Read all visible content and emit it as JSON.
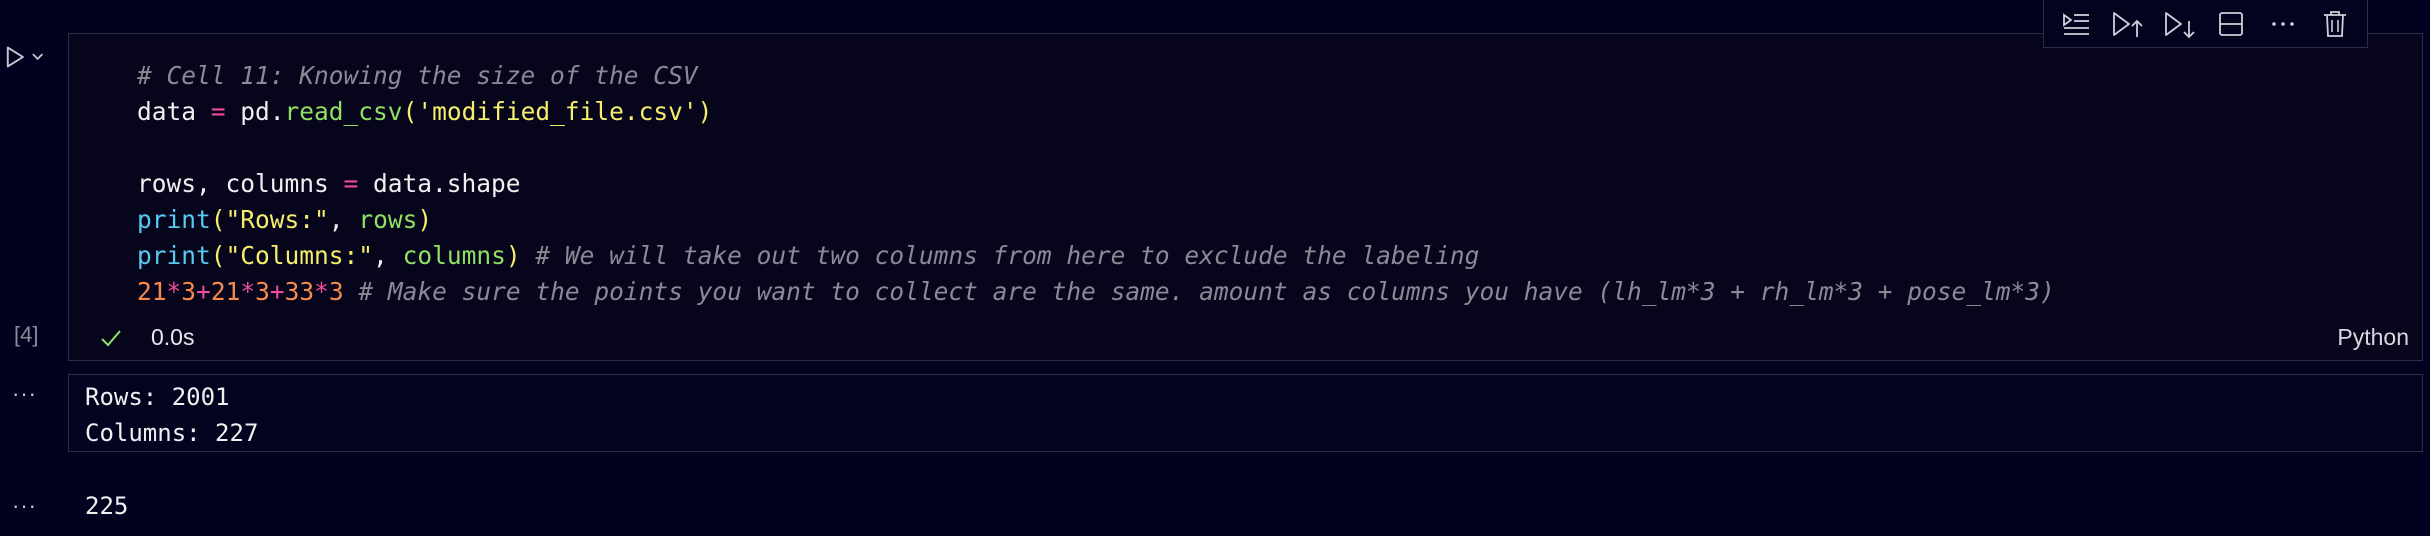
{
  "cell": {
    "execution_count": "[4]",
    "duration": "0.0s",
    "language": "Python",
    "code_lines": [
      [
        {
          "t": "# Cell 11: Knowing the size of the CSV",
          "c": "cm"
        }
      ],
      [
        {
          "t": "data ",
          "c": "vr"
        },
        {
          "t": "=",
          "c": "op"
        },
        {
          "t": " pd.",
          "c": "vr"
        },
        {
          "t": "read_csv",
          "c": "fn"
        },
        {
          "t": "(",
          "c": "pn"
        },
        {
          "t": "'modified_file.csv'",
          "c": "st"
        },
        {
          "t": ")",
          "c": "pn"
        }
      ],
      [],
      [
        {
          "t": "rows, columns ",
          "c": "vr"
        },
        {
          "t": "=",
          "c": "op"
        },
        {
          "t": " data.shape",
          "c": "vr"
        }
      ],
      [
        {
          "t": "print",
          "c": "bi"
        },
        {
          "t": "(",
          "c": "pn"
        },
        {
          "t": "\"Rows:\"",
          "c": "st"
        },
        {
          "t": ", ",
          "c": "vr"
        },
        {
          "t": "rows",
          "c": "fn"
        },
        {
          "t": ")",
          "c": "pn"
        }
      ],
      [
        {
          "t": "print",
          "c": "bi"
        },
        {
          "t": "(",
          "c": "pn"
        },
        {
          "t": "\"Columns:\"",
          "c": "st"
        },
        {
          "t": ", ",
          "c": "vr"
        },
        {
          "t": "columns",
          "c": "fn"
        },
        {
          "t": ")",
          "c": "pn"
        },
        {
          "t": " # We will take out two columns from here to exclude the labeling",
          "c": "cm"
        }
      ],
      [
        {
          "t": "21",
          "c": "nm"
        },
        {
          "t": "*",
          "c": "op"
        },
        {
          "t": "3",
          "c": "nm"
        },
        {
          "t": "+",
          "c": "op"
        },
        {
          "t": "21",
          "c": "nm"
        },
        {
          "t": "*",
          "c": "op"
        },
        {
          "t": "3",
          "c": "nm"
        },
        {
          "t": "+",
          "c": "op"
        },
        {
          "t": "33",
          "c": "nm"
        },
        {
          "t": "*",
          "c": "op"
        },
        {
          "t": "3",
          "c": "nm"
        },
        {
          "t": " # Make sure the points you want to collect are the same. amount as columns you have (lh_lm*3 + rh_lm*3 + pose_lm*3)",
          "c": "cm"
        }
      ]
    ]
  },
  "toolbar": {
    "buttons": [
      {
        "name": "run-by-line-button",
        "icon": "run-by-line-icon"
      },
      {
        "name": "execute-above-button",
        "icon": "execute-above-icon"
      },
      {
        "name": "execute-below-button",
        "icon": "execute-below-icon"
      },
      {
        "name": "split-cell-button",
        "icon": "split-cell-icon"
      },
      {
        "name": "more-actions-button",
        "icon": "more-icon"
      },
      {
        "name": "delete-cell-button",
        "icon": "trash-icon"
      }
    ]
  },
  "outputs": {
    "more_label": "···",
    "stream_lines": [
      "Rows: 2001",
      "Columns: 227"
    ],
    "result": "225"
  },
  "colors": {
    "background": "#01021f",
    "border": "#2b2d48",
    "check": "#8fe063"
  }
}
